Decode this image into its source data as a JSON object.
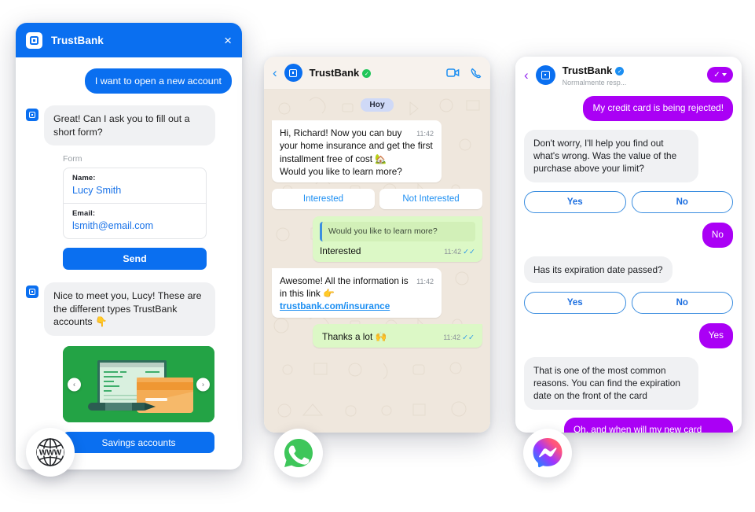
{
  "brand": {
    "name": "TrustBank",
    "accent_blue": "#0a6ff0",
    "whatsapp_green": "#25d366",
    "messenger_purple": "#aa00f5",
    "bubble_green": "#dcf8c6",
    "wa_bg": "#efe7dd"
  },
  "web_chat": {
    "header": {
      "title": "TrustBank",
      "logo_icon": "trustbank-logo-icon",
      "close_icon": "close-icon",
      "close_label": "×"
    },
    "messages": [
      {
        "from": "user",
        "text": "I want to open a new account"
      },
      {
        "from": "bot",
        "text": "Great! Can I ask you to fill out a short form?"
      }
    ],
    "form": {
      "caption": "Form",
      "fields": [
        {
          "label": "Name:",
          "value": "Lucy Smith"
        },
        {
          "label": "Email:",
          "value": "lsmith@email.com"
        }
      ],
      "submit_label": "Send"
    },
    "second_bot_message": "Nice to meet you, Lucy! These are the different types TrustBank accounts 👇",
    "carousel": {
      "prev_icon": "chevron-left-icon",
      "next_icon": "chevron-right-icon",
      "prev_label": "‹",
      "next_label": "›",
      "card_alt": "laptop-and-credit-card-illustration"
    },
    "cta_label": "Savings accounts",
    "badge": {
      "icon": "www-globe-icon",
      "label": "WWW"
    }
  },
  "whatsapp": {
    "header": {
      "back_icon": "back-chevron-icon",
      "back_label": "‹",
      "avatar_icon": "trustbank-avatar-icon",
      "name": "TrustBank",
      "verified_icon": "verified-badge-icon",
      "verified_mark": "✓",
      "video_icon": "video-call-icon",
      "phone_icon": "phone-call-icon"
    },
    "day_divider": "Hoy",
    "messages": [
      {
        "from": "in",
        "text": "Hi, Richard! Now you can buy your home insurance and get the first installment free of cost 🏡\nWould you like to learn more?",
        "time": "11:42"
      }
    ],
    "quick_replies": [
      "Interested",
      "Not Interested"
    ],
    "reply_message": {
      "quote": "Would you like to learn more?",
      "text": "Interested",
      "time": "11:42",
      "ticks": "✓✓"
    },
    "link_message": {
      "prefix": "Awesome! All the information is in this link 👉 ",
      "link": "trustbank.com/insurance",
      "time": "11:42"
    },
    "thanks_message": {
      "text": "Thanks a lot 🙌",
      "time": "11:42",
      "ticks": "✓✓"
    },
    "badge": {
      "icon": "whatsapp-icon",
      "label": "WhatsApp"
    }
  },
  "messenger": {
    "header": {
      "back_icon": "back-chevron-icon",
      "back_label": "‹",
      "avatar_icon": "trustbank-avatar-icon",
      "name": "TrustBank",
      "verified_icon": "verified-badge-icon",
      "verified_mark": "✓",
      "subtitle": "Normalmente resp...",
      "action_icon": "check-dropdown-icon",
      "action_check": "✓"
    },
    "messages": [
      {
        "from": "out",
        "text": "My credit card is being rejected!"
      },
      {
        "from": "in",
        "text": "Don't worry, I'll help you find out what's wrong. Was the value of the purchase above your limit?"
      },
      {
        "from": "out",
        "text": "No"
      },
      {
        "from": "in",
        "text": "Has its expiration date passed?"
      },
      {
        "from": "out",
        "text": "Yes"
      },
      {
        "from": "in",
        "text": "That is one of the most common reasons. You can find the expiration date on the front of the card"
      },
      {
        "from": "out",
        "text": "Oh, and when will my new card arrive?"
      }
    ],
    "quick_replies_1": [
      "Yes",
      "No"
    ],
    "quick_replies_2": [
      "Yes",
      "No"
    ],
    "badge": {
      "icon": "messenger-icon",
      "label": "Messenger"
    }
  }
}
